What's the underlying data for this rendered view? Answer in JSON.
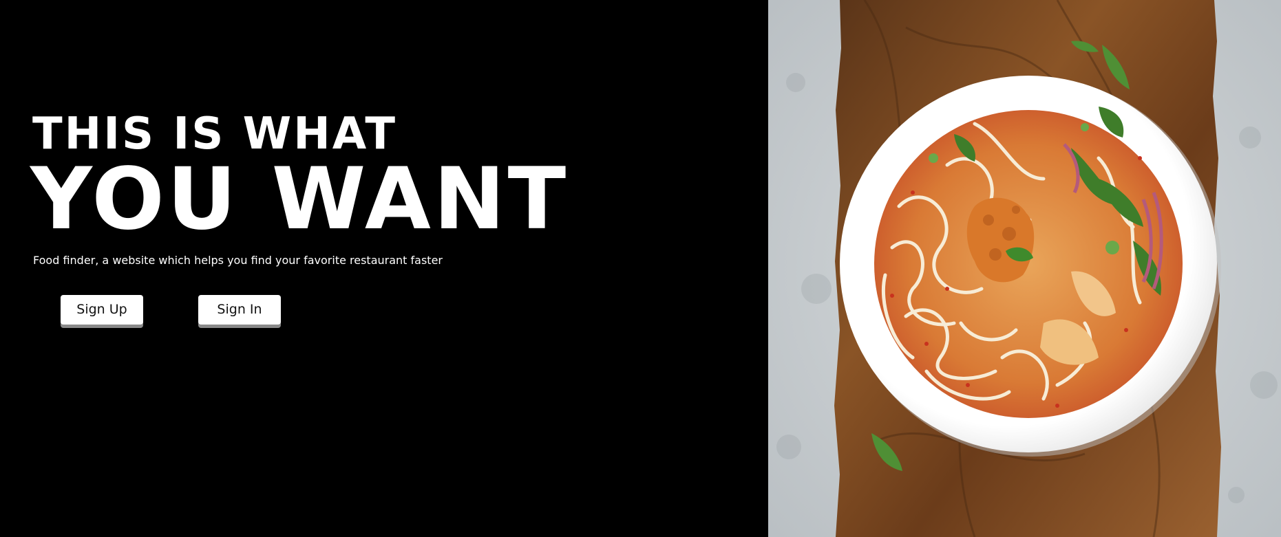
{
  "hero": {
    "line1": "THIS IS WHAT",
    "line2": "YOU WANT",
    "tagline": "Food finder, a website which helps you find your favorite restaurant faster"
  },
  "actions": {
    "sign_up_label": "Sign Up",
    "sign_in_label": "Sign In"
  },
  "colors": {
    "background": "#000000",
    "text": "#ffffff",
    "button_bg": "#ffffff",
    "button_shadow": "#8a8a8a"
  }
}
